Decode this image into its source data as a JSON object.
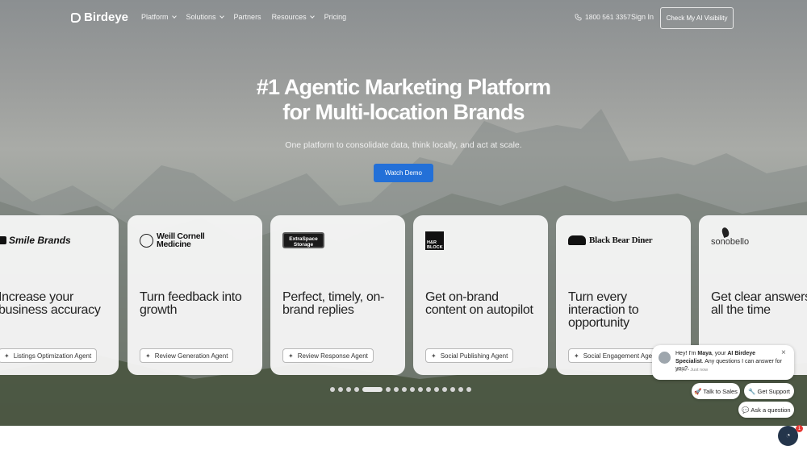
{
  "nav": {
    "brand": "Birdeye",
    "menu": [
      {
        "label": "Platform",
        "dropdown": true
      },
      {
        "label": "Solutions",
        "dropdown": true
      },
      {
        "label": "Partners",
        "dropdown": false
      },
      {
        "label": "Resources",
        "dropdown": true
      },
      {
        "label": "Pricing",
        "dropdown": false
      }
    ],
    "phone": "1800 561 3357",
    "signin": "Sign In",
    "cta": "Check My AI Visibility"
  },
  "hero": {
    "title_line1": "#1 Agentic Marketing Platform",
    "title_line2": "for Multi-location Brands",
    "subtitle": "One platform to consolidate data, think locally, and act at scale.",
    "cta": "Watch Demo"
  },
  "cards": [
    {
      "brand": "Smile Brands",
      "headline": "Increase your business accuracy",
      "tag": "Listings Optimization Agent"
    },
    {
      "brand": "Weill Cornell Medicine",
      "headline": "Turn feedback into growth",
      "tag": "Review Generation Agent"
    },
    {
      "brand": "ExtraSpace Storage",
      "headline": "Perfect, timely, on-brand replies",
      "tag": "Review Response Agent"
    },
    {
      "brand": "H&R BLOCK",
      "headline": "Get on-brand content on autopilot",
      "tag": "Social Publishing Agent"
    },
    {
      "brand": "Black Bear Diner",
      "headline": "Turn every interaction to opportunity",
      "tag": "Social Engagement Agent"
    },
    {
      "brand": "sonobello",
      "headline": "Get clear answers all the time",
      "tag": ""
    }
  ],
  "carousel": {
    "total": 16,
    "active": 4
  },
  "chat": {
    "message_prefix": "Hey! I'm ",
    "agent_name": "Maya",
    "message_mid": ", your ",
    "agent_role": "AI Birdeye Specialist",
    "message_suffix": ". Any questions I can answer for you?",
    "meta": "Maya • Just now",
    "quick_replies": [
      "🚀 Talk to Sales",
      "🔧 Get Support",
      "💬 Ask a question"
    ],
    "badge": "1"
  },
  "colors": {
    "accent": "#2370d8",
    "chat_fab": "#24354b",
    "badge": "#e53935"
  }
}
